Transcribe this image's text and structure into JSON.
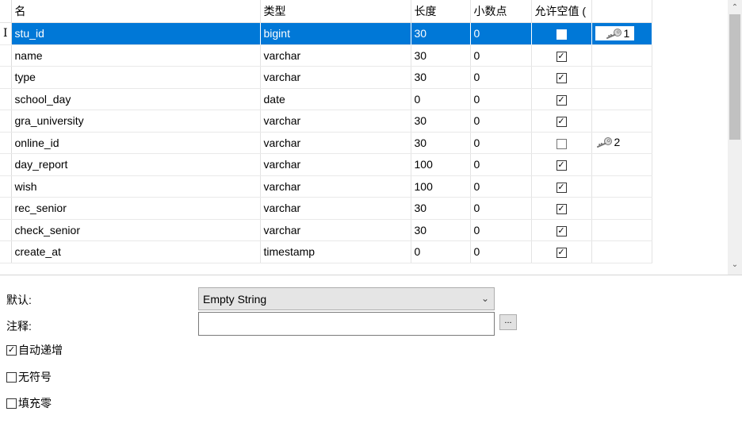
{
  "columns": {
    "name": "名",
    "type": "类型",
    "length": "长度",
    "decimals": "小数点",
    "nullable": "允许空值 ("
  },
  "selected_marker": "I",
  "rows": [
    {
      "name": "stu_id",
      "type": "bigint",
      "length": "30",
      "decimals": "0",
      "nullable": false,
      "key": "1"
    },
    {
      "name": "name",
      "type": "varchar",
      "length": "30",
      "decimals": "0",
      "nullable": true,
      "key": ""
    },
    {
      "name": "type",
      "type": "varchar",
      "length": "30",
      "decimals": "0",
      "nullable": true,
      "key": ""
    },
    {
      "name": "school_day",
      "type": "date",
      "length": "0",
      "decimals": "0",
      "nullable": true,
      "key": ""
    },
    {
      "name": "gra_university",
      "type": "varchar",
      "length": "30",
      "decimals": "0",
      "nullable": true,
      "key": ""
    },
    {
      "name": "online_id",
      "type": "varchar",
      "length": "30",
      "decimals": "0",
      "nullable": false,
      "key": "2"
    },
    {
      "name": "day_report",
      "type": "varchar",
      "length": "100",
      "decimals": "0",
      "nullable": true,
      "key": ""
    },
    {
      "name": "wish",
      "type": "varchar",
      "length": "100",
      "decimals": "0",
      "nullable": true,
      "key": ""
    },
    {
      "name": "rec_senior",
      "type": "varchar",
      "length": "30",
      "decimals": "0",
      "nullable": true,
      "key": ""
    },
    {
      "name": "check_senior",
      "type": "varchar",
      "length": "30",
      "decimals": "0",
      "nullable": true,
      "key": ""
    },
    {
      "name": "create_at",
      "type": "timestamp",
      "length": "0",
      "decimals": "0",
      "nullable": true,
      "key": ""
    }
  ],
  "props": {
    "default_label": "默认:",
    "default_value": "Empty String",
    "comment_label": "注释:",
    "comment_value": "",
    "ellipsis": "...",
    "auto_increment": {
      "label": "自动递增",
      "checked": true
    },
    "unsigned": {
      "label": "无符号",
      "checked": false
    },
    "zerofill": {
      "label": "填充零",
      "checked": false
    }
  },
  "icons": {
    "key": "key-icon",
    "up": "scroll-up-icon",
    "down": "scroll-down-icon",
    "dropdown": "chevron-down-icon"
  }
}
